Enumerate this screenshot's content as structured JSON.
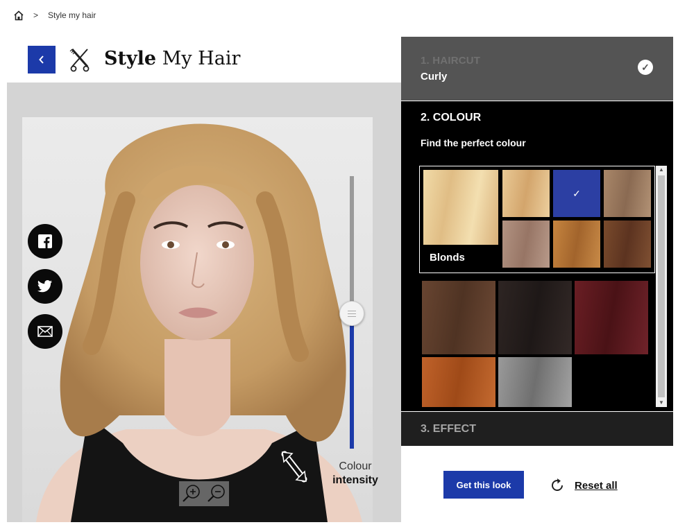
{
  "breadcrumb": {
    "separator": ">",
    "current": "Style my hair"
  },
  "header": {
    "title_bold": "Style",
    "title_rest": "My Hair"
  },
  "colour_intensity": {
    "line1": "Colour",
    "line2": "intensity",
    "level": 0.5
  },
  "steps": {
    "haircut": {
      "label": "1. HAIRCUT",
      "value": "Curly",
      "completed": true
    },
    "colour": {
      "label": "2. COLOUR",
      "subtitle": "Find the perfect colour",
      "group_label": "Blonds",
      "blond_swatches": [
        "#e7c792",
        "#2c3fa3",
        "#9d8068",
        "#a6836f",
        "#b97c3c",
        "#6b4228"
      ],
      "selected_swatch": 1,
      "other_swatches": [
        "#5b3b28",
        "#2a2120",
        "#5e1a1e",
        "#b5561e",
        "#8c8c8c"
      ],
      "big_swatch": "#eacf97"
    },
    "effect": {
      "label": "3. EFFECT"
    }
  },
  "actions": {
    "get_look": "Get this look",
    "reset": "Reset all"
  },
  "colors": {
    "accent": "#1c3aa9",
    "panel_dark": "#000000",
    "panel_done": "#545454"
  }
}
